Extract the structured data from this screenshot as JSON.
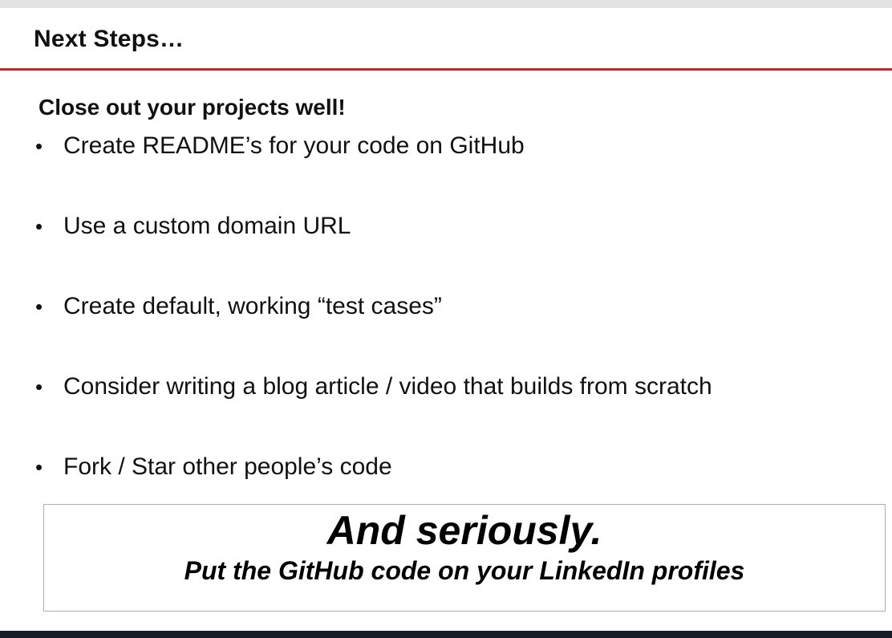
{
  "slide": {
    "title": "Next Steps…",
    "heading": "Close out your projects well!",
    "bullet_symbol": "•",
    "bullets": [
      "Create README’s for your code on GitHub",
      "Use a custom domain URL",
      "Create default, working “test cases”",
      "Consider writing a blog article / video that builds from scratch",
      "Fork / Star other people’s code"
    ],
    "callout": {
      "headline": "And seriously.",
      "subline": "Put the GitHub code on your LinkedIn profiles"
    }
  },
  "colors": {
    "title_rule": "#c8262a",
    "bottom_bar": "#1a1c2c"
  }
}
